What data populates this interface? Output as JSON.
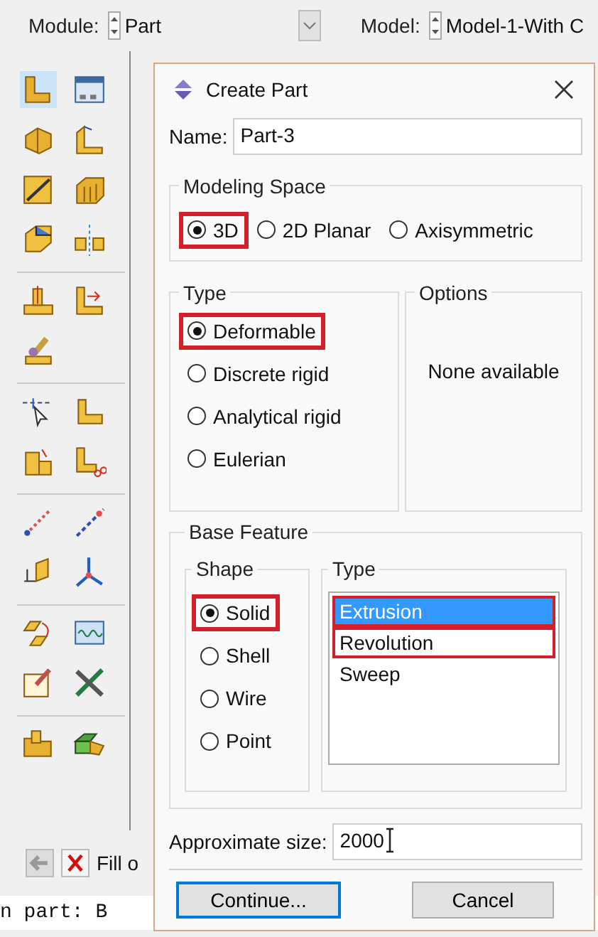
{
  "top_bar": {
    "module_label": "Module:",
    "module_value": "Part",
    "model_label": "Model:",
    "model_value": "Model-1-With C"
  },
  "prompt": {
    "text": "Fill o"
  },
  "message": {
    "text": "n part: B"
  },
  "dialog": {
    "title": "Create Part",
    "name_label": "Name:",
    "name_value": "Part-3",
    "modeling_space": {
      "title": "Modeling Space",
      "options": [
        {
          "label": "3D",
          "selected": true,
          "highlighted": true
        },
        {
          "label": "2D Planar",
          "selected": false,
          "highlighted": false
        },
        {
          "label": "Axisymmetric",
          "selected": false,
          "highlighted": false
        }
      ]
    },
    "type": {
      "title": "Type",
      "options": [
        {
          "label": "Deformable",
          "selected": true,
          "highlighted": true
        },
        {
          "label": "Discrete rigid",
          "selected": false,
          "highlighted": false
        },
        {
          "label": "Analytical rigid",
          "selected": false,
          "highlighted": false
        },
        {
          "label": "Eulerian",
          "selected": false,
          "highlighted": false
        }
      ]
    },
    "options": {
      "title": "Options",
      "text": "None available"
    },
    "base_feature": {
      "title": "Base Feature",
      "shape": {
        "title": "Shape",
        "options": [
          {
            "label": "Solid",
            "selected": true,
            "highlighted": true
          },
          {
            "label": "Shell",
            "selected": false,
            "highlighted": false
          },
          {
            "label": "Wire",
            "selected": false,
            "highlighted": false
          },
          {
            "label": "Point",
            "selected": false,
            "highlighted": false
          }
        ]
      },
      "type": {
        "title": "Type",
        "items": [
          {
            "label": "Extrusion",
            "selected": true,
            "highlighted": true
          },
          {
            "label": "Revolution",
            "selected": false,
            "highlighted": true
          },
          {
            "label": "Sweep",
            "selected": false,
            "highlighted": false
          }
        ]
      }
    },
    "size_label": "Approximate size:",
    "size_value": "2000",
    "buttons": [
      {
        "label": "Continue...",
        "default": true
      },
      {
        "label": "Cancel",
        "default": false
      }
    ]
  }
}
